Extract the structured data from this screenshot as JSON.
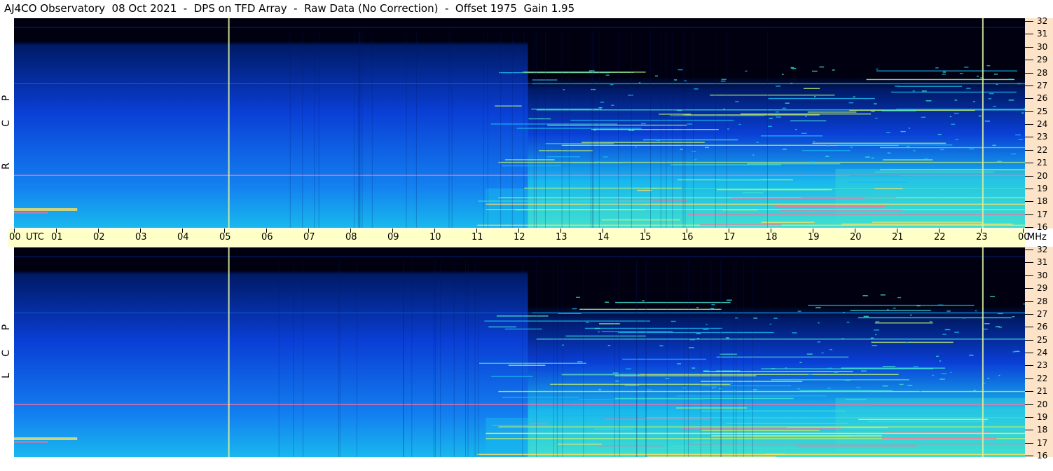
{
  "title": "AJ4CO Observatory  08 Oct 2021  -  DPS on TFD Array  -  Raw Data (No Correction)  -  Offset 1975  Gain 1.95",
  "panels": [
    {
      "id": "rcp",
      "label_letters": [
        "R",
        "C",
        "P"
      ]
    },
    {
      "id": "lcp",
      "label_letters": [
        "L",
        "C",
        "P"
      ]
    }
  ],
  "time_axis": {
    "unit_label": "UTC",
    "labels": [
      "00",
      "01",
      "02",
      "03",
      "04",
      "05",
      "06",
      "07",
      "08",
      "09",
      "10",
      "11",
      "12",
      "13",
      "14",
      "15",
      "16",
      "17",
      "18",
      "19",
      "20",
      "21",
      "22",
      "23",
      "00"
    ]
  },
  "freq_axis": {
    "unit_label": "MHz",
    "labels": [
      "32",
      "31",
      "30",
      "29",
      "28",
      "27",
      "26",
      "25",
      "24",
      "23",
      "22",
      "21",
      "20",
      "19",
      "18",
      "17",
      "16"
    ]
  },
  "chart_data": {
    "type": "heatmap",
    "title": "AJ4CO Observatory  08 Oct 2021  -  DPS on TFD Array  -  Raw Data (No Correction)  -  Offset 1975  Gain 1.95",
    "xlabel": "UTC",
    "ylabel": "MHz",
    "x_range": [
      0,
      24
    ],
    "y_range": [
      16,
      32
    ],
    "series": [
      {
        "name": "RCP"
      },
      {
        "name": "LCP"
      }
    ],
    "vertical_lines_utc": [
      5.1,
      23.0
    ],
    "colorscale": [
      "#000010",
      "#001a66",
      "#0a3fd6",
      "#1380f0",
      "#18b8ee",
      "#40e0d0",
      "#b8f070",
      "#ffe060",
      "#ff70a0"
    ]
  }
}
